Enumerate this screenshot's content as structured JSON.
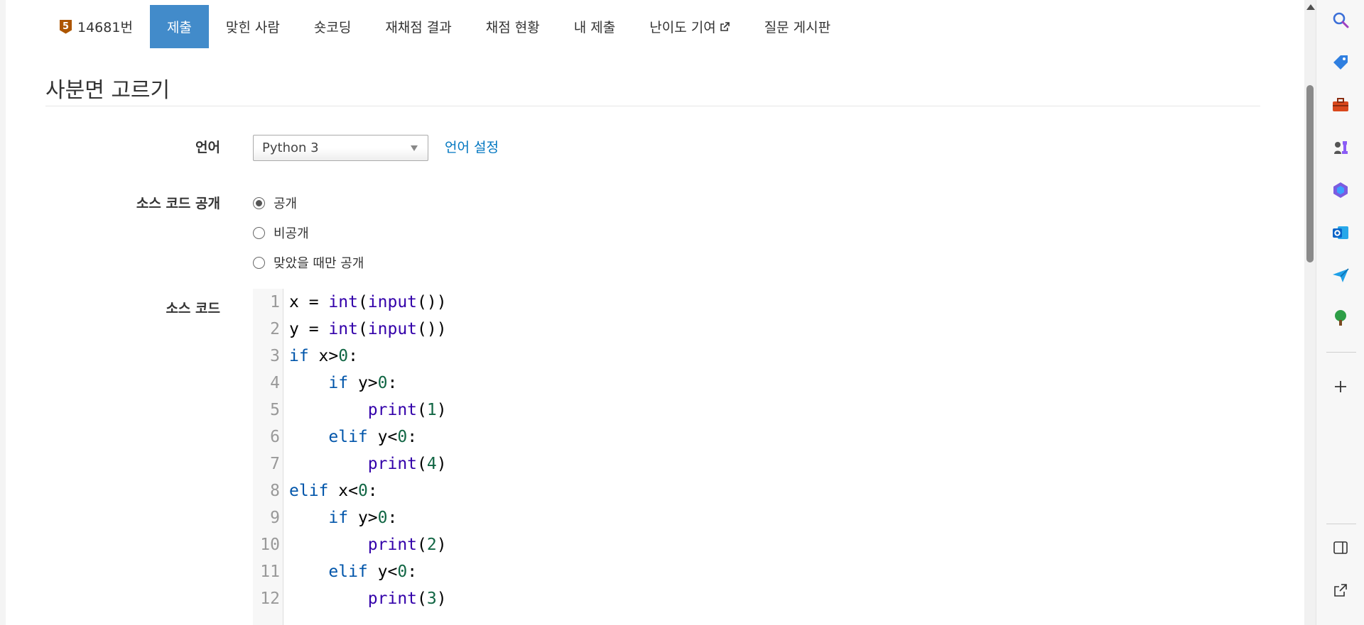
{
  "nav": {
    "problem_badge": "5",
    "problem_label": "14681번",
    "tabs": [
      {
        "label": "제출",
        "active": true
      },
      {
        "label": "맞힌 사람"
      },
      {
        "label": "숏코딩"
      },
      {
        "label": "재채점 결과"
      },
      {
        "label": "채점 현황"
      },
      {
        "label": "내 제출"
      },
      {
        "label": "난이도 기여"
      },
      {
        "label": "질문 게시판"
      }
    ]
  },
  "page": {
    "title": "사분면 고르기"
  },
  "form": {
    "language_label": "언어",
    "language_value": "Python 3",
    "language_settings_link": "언어 설정",
    "visibility_label": "소스 코드 공개",
    "visibility_options": [
      {
        "label": "공개",
        "checked": true
      },
      {
        "label": "비공개",
        "checked": false
      },
      {
        "label": "맞았을 때만 공개",
        "checked": false
      }
    ],
    "source_label": "소스 코드"
  },
  "code": {
    "line_numbers": [
      "1",
      "2",
      "3",
      "4",
      "5",
      "6",
      "7",
      "8",
      "9",
      "10",
      "11",
      "12"
    ]
  },
  "colors": {
    "active_tab": "#428bca",
    "link": "#0076c0",
    "badge": "#ad5600"
  },
  "sidebar": {
    "icons": [
      "search-icon",
      "tag-icon",
      "toolbox-icon",
      "chess-icon",
      "copilot-icon",
      "outlook-icon",
      "send-icon",
      "tree-icon",
      "add-icon",
      "split-view-icon",
      "open-external-icon"
    ]
  }
}
